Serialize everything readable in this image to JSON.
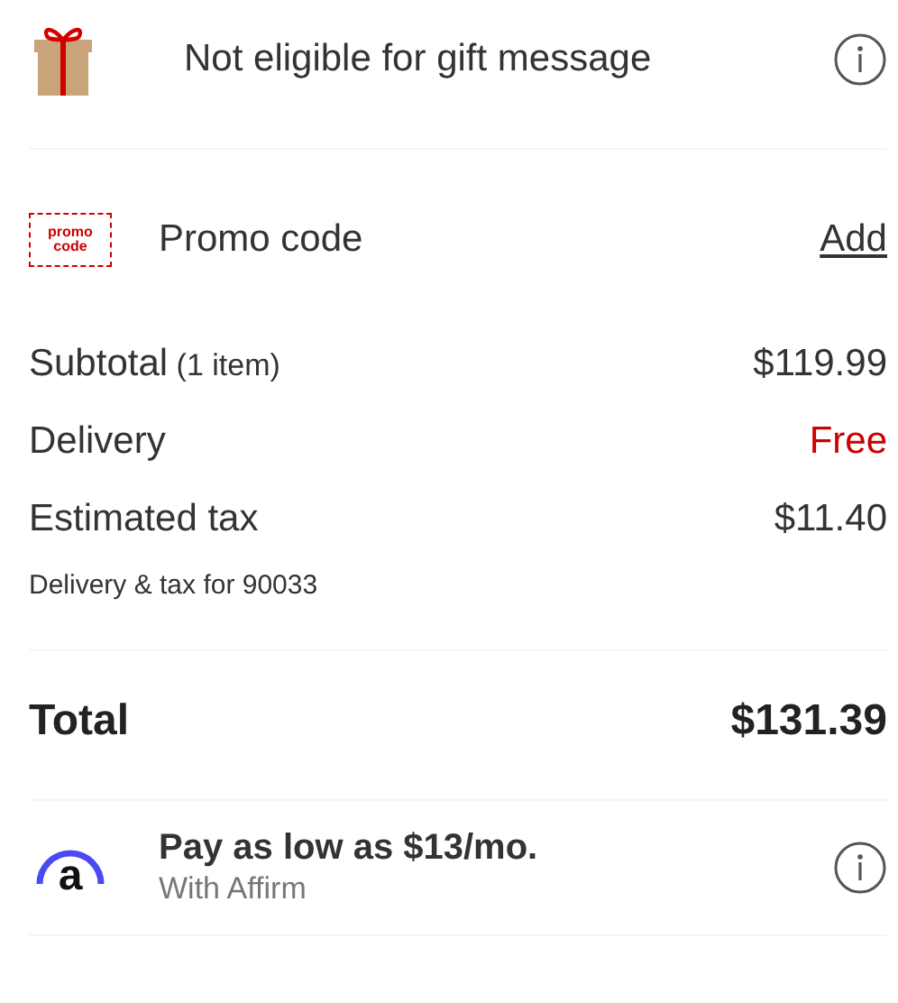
{
  "gift": {
    "text": "Not eligible for gift message"
  },
  "promo": {
    "icon_text": "promo code",
    "label": "Promo code",
    "link": "Add"
  },
  "summary_lines": [
    {
      "label": "Subtotal",
      "note": "(1 item)",
      "value": "$119.99",
      "color": "#333333"
    },
    {
      "label": "Delivery",
      "value": "Free",
      "color": "#cc0000"
    },
    {
      "label": "Estimated tax",
      "value": "$11.40",
      "color": "#333333"
    }
  ],
  "location_note": "Delivery & tax for 90033",
  "total": {
    "label": "Total",
    "value": "$131.39"
  },
  "affirm": {
    "logo_letter": "a",
    "title": "Pay as low as $13/mo.",
    "subtitle": "With Affirm"
  }
}
